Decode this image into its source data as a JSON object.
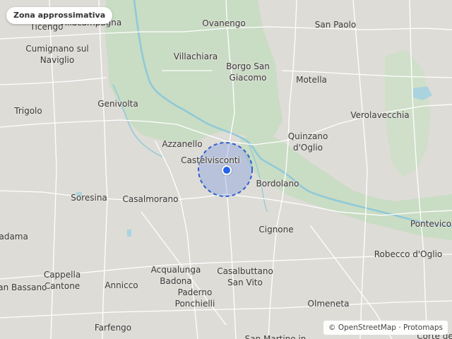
{
  "map": {
    "badge": "Zona approssimativa",
    "attribution": "© OpenStreetMap · Protomaps",
    "marker": {
      "type": "approximate-location",
      "color": "#2563eb"
    },
    "colors": {
      "land": "#dedcd7",
      "park": "#c9dcc4",
      "river": "#8ec9d8",
      "road": "#ffffff"
    },
    "places": [
      {
        "key": "ticengo",
        "label": "Ticengo"
      },
      {
        "key": "villacampagna",
        "label": "Villacampagna"
      },
      {
        "key": "ovanengo",
        "label": "Ovanengo"
      },
      {
        "key": "san_paolo",
        "label": "San Paolo"
      },
      {
        "key": "cumignano",
        "label": "Cumignano sul\nNaviglio"
      },
      {
        "key": "villachiara",
        "label": "Villachiara"
      },
      {
        "key": "borgo_san_giacomo",
        "label": "Borgo San\nGiacomo"
      },
      {
        "key": "motella",
        "label": "Motella"
      },
      {
        "key": "trigolo",
        "label": "Trigolo"
      },
      {
        "key": "genivolta",
        "label": "Genivolta"
      },
      {
        "key": "verolavecchia",
        "label": "Verolavecchia"
      },
      {
        "key": "azzanello",
        "label": "Azzanello"
      },
      {
        "key": "quinzano",
        "label": "Quinzano\nd'Oglio"
      },
      {
        "key": "castelvisconti",
        "label": "Castelvisconti"
      },
      {
        "key": "bordolano",
        "label": "Bordolano"
      },
      {
        "key": "soresina",
        "label": "Soresina"
      },
      {
        "key": "casalmorano",
        "label": "Casalmorano"
      },
      {
        "key": "pontevico",
        "label": "Pontevico"
      },
      {
        "key": "cignone",
        "label": "Cignone"
      },
      {
        "key": "madama",
        "label": "Madama"
      },
      {
        "key": "robecco",
        "label": "Robecco d'Oglio"
      },
      {
        "key": "cappella_cantone",
        "label": "Cappella\nCantone"
      },
      {
        "key": "san_bassano",
        "label": "San Bassano"
      },
      {
        "key": "acqualunga",
        "label": "Acqualunga\nBadona"
      },
      {
        "key": "casalbuttano",
        "label": "Casalbuttano\nSan Vito"
      },
      {
        "key": "annicco",
        "label": "Annicco"
      },
      {
        "key": "paderno",
        "label": "Paderno\nPonchielli"
      },
      {
        "key": "olmeneta",
        "label": "Olmeneta"
      },
      {
        "key": "farfengo",
        "label": "Farfengo"
      },
      {
        "key": "corte_de",
        "label": "Corte de"
      },
      {
        "key": "san_martino",
        "label": "San Martino in"
      }
    ]
  }
}
